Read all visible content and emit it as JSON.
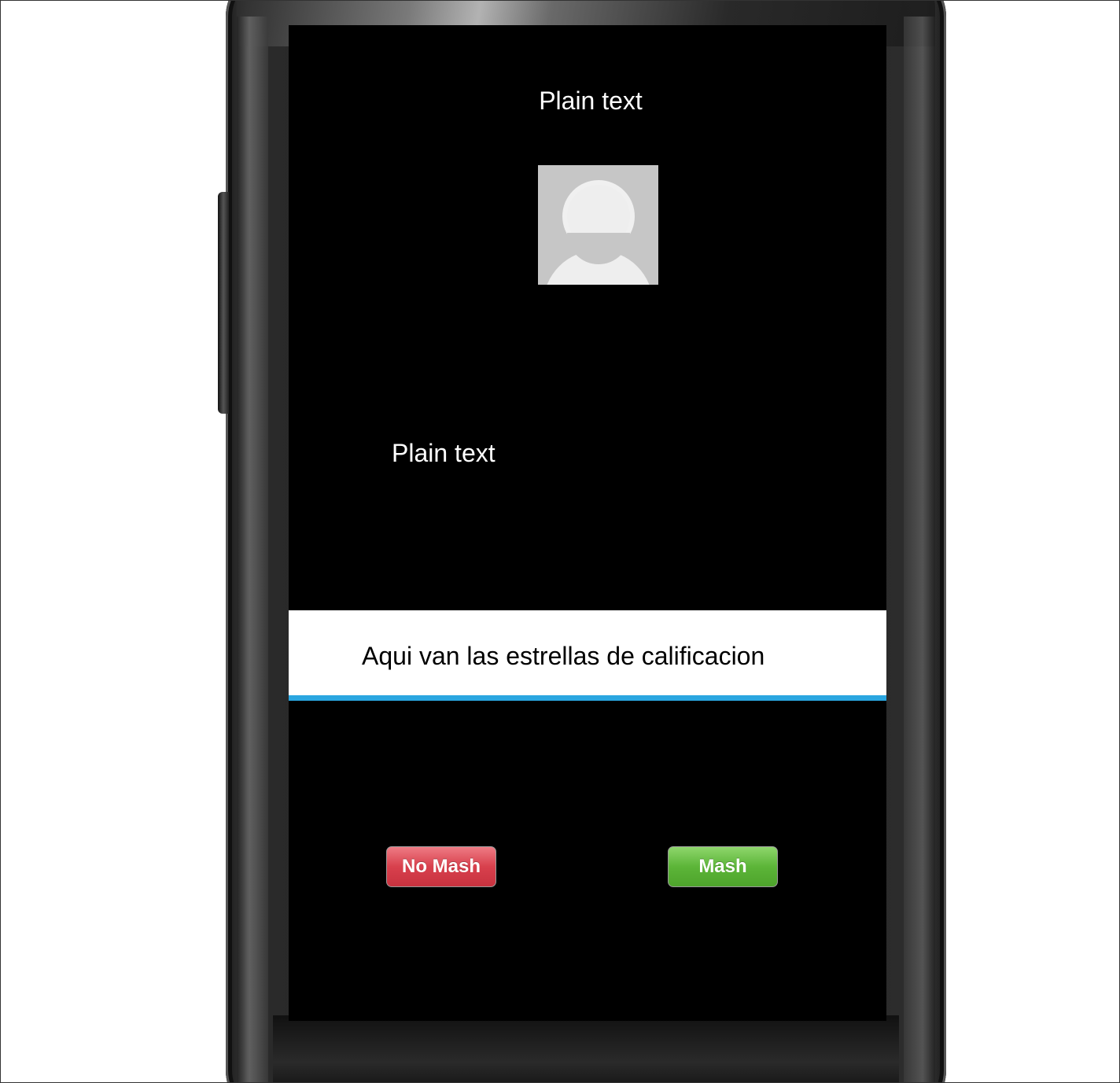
{
  "screen": {
    "title": "Plain text",
    "subtitle": "Plain text",
    "avatar_icon": "user-placeholder-icon",
    "rating_placeholder": "Aqui van las estrellas de calificacion",
    "buttons": {
      "no_mash": "No Mash",
      "mash": "Mash"
    }
  },
  "colors": {
    "screen_background": "#000000",
    "rating_underline": "#2aa6e0",
    "no_mash_button": "#d8404d",
    "mash_button": "#5cb538",
    "avatar_background": "#c6c6c6"
  }
}
